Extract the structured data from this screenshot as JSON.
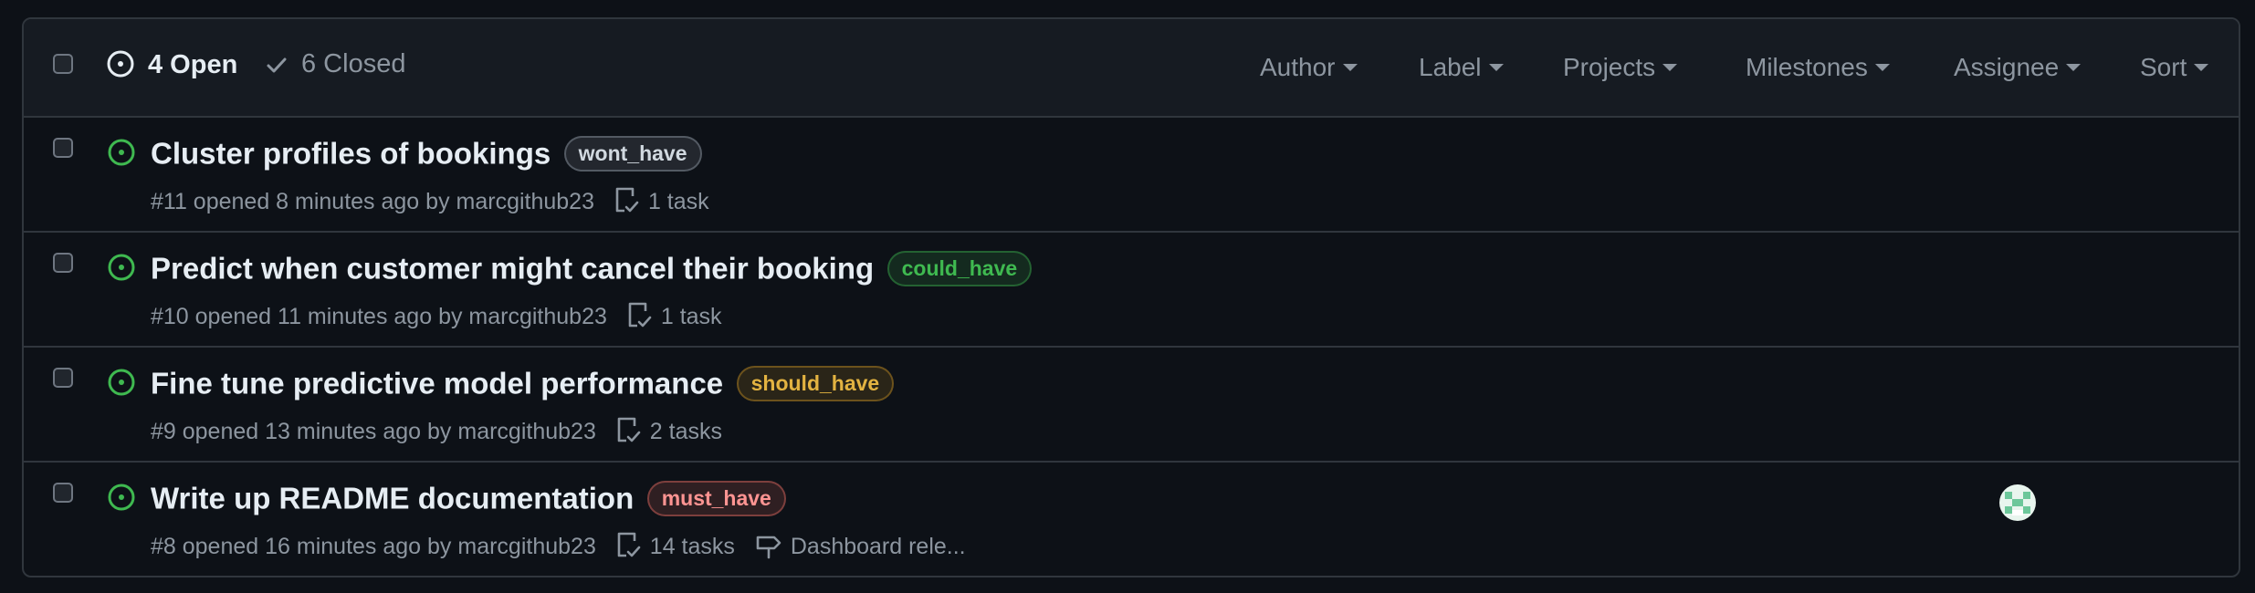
{
  "header": {
    "open_count": "4 Open",
    "closed_count": "6 Closed",
    "filters": [
      "Author",
      "Label",
      "Projects",
      "Milestones",
      "Assignee",
      "Sort"
    ]
  },
  "issues": [
    {
      "title": "Cluster profiles of bookings",
      "label": "wont_have",
      "label_color": "#9ea7b3",
      "meta": "#11 opened 8 minutes ago by marcgithub23",
      "tasks": "1 task"
    },
    {
      "title": "Predict when customer might cancel their booking",
      "label": "could_have",
      "label_color": "#3fb950",
      "meta": "#10 opened 11 minutes ago by marcgithub23",
      "tasks": "1 task"
    },
    {
      "title": "Fine tune predictive model performance",
      "label": "should_have",
      "label_color": "#d29922",
      "meta": "#9 opened 13 minutes ago by marcgithub23",
      "tasks": "2 tasks"
    },
    {
      "title": "Write up README documentation",
      "label": "must_have",
      "label_color": "#f47067",
      "meta": "#8 opened 16 minutes ago by marcgithub23",
      "tasks": "14 tasks",
      "milestone": "Dashboard rele..."
    }
  ],
  "colors": {
    "open_issue": "#3fb950",
    "label_wont_have_bg": "#9ea7b326",
    "label_could_have_bg": "#3fb95026",
    "label_should_have_bg": "#d2992226",
    "label_must_have_bg": "#f4706726"
  },
  "icons": {
    "open_state": "issue-open-icon",
    "closed_state": "check-icon",
    "tasks": "task-list-icon",
    "milestone": "milestone-icon"
  }
}
